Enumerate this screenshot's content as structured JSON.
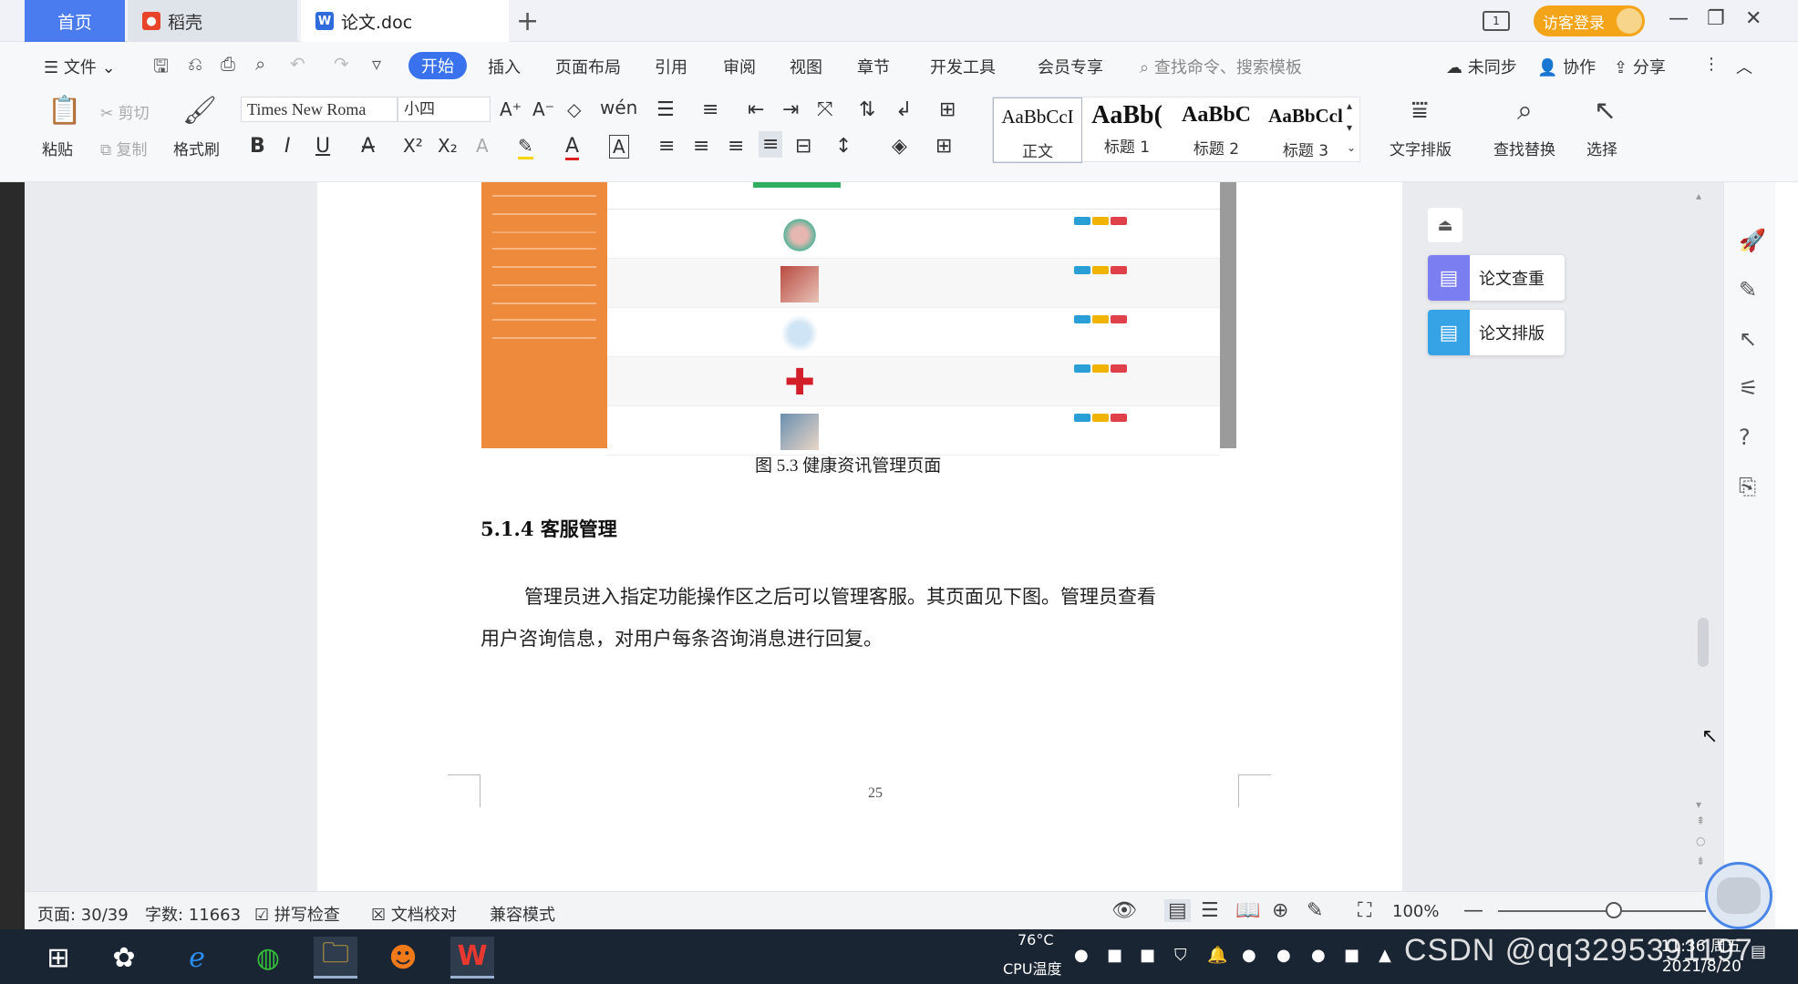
{
  "tabs": {
    "home": "首页",
    "daoke": "稻壳",
    "doc": "论文.doc",
    "add": "+"
  },
  "titlebar": {
    "visitor_login": "访客登录",
    "page_indicator": "1"
  },
  "menu": {
    "file": "文件",
    "items": [
      "开始",
      "插入",
      "页面布局",
      "引用",
      "审阅",
      "视图",
      "章节",
      "开发工具",
      "会员专享"
    ],
    "search_placeholder": "查找命令、搜索模板",
    "unsynced": "未同步",
    "collaborate": "协作",
    "share": "分享"
  },
  "ribbon": {
    "paste": "粘贴",
    "cut": "剪切",
    "copy": "复制",
    "format_painter": "格式刷",
    "font_name": "Times New Roma",
    "font_size": "小四",
    "styles": [
      {
        "preview": "AaBbCcI",
        "name": "正文"
      },
      {
        "preview": "AaBb(",
        "name": "标题 1"
      },
      {
        "preview": "AaBbC",
        "name": "标题 2"
      },
      {
        "preview": "AaBbCcl",
        "name": "标题 3"
      }
    ],
    "text_layout": "文字排版",
    "find_replace": "查找替换",
    "select": "选择"
  },
  "document": {
    "figure_caption": "图 5.3  健康资讯管理页面",
    "section_heading": "5.1.4  客服管理",
    "paragraph_line1": "管理员进入指定功能操作区之后可以管理客服。其页面见下图。管理员查看",
    "paragraph_line2": "用户咨询信息，对用户每条咨询消息进行回复。",
    "page_number": "25"
  },
  "right_panel": {
    "plagiarism_check": "论文查重",
    "thesis_format": "论文排版"
  },
  "statusbar": {
    "page": "页面: 30/39",
    "word_count": "字数: 11663",
    "spell_check": "拼写检查",
    "doc_proof": "文档校对",
    "compat_mode": "兼容模式",
    "zoom": "100%"
  },
  "taskbar": {
    "cpu_temp": "76°C",
    "cpu_label": "CPU温度",
    "time": "11:36 周五",
    "date": "2021/8/20",
    "watermark": "CSDN @qq3295391197"
  },
  "colors": {
    "accent": "#3a72ee",
    "orange_sidebar": "#ee8a3c",
    "visitor_orange": "#f3a419"
  }
}
